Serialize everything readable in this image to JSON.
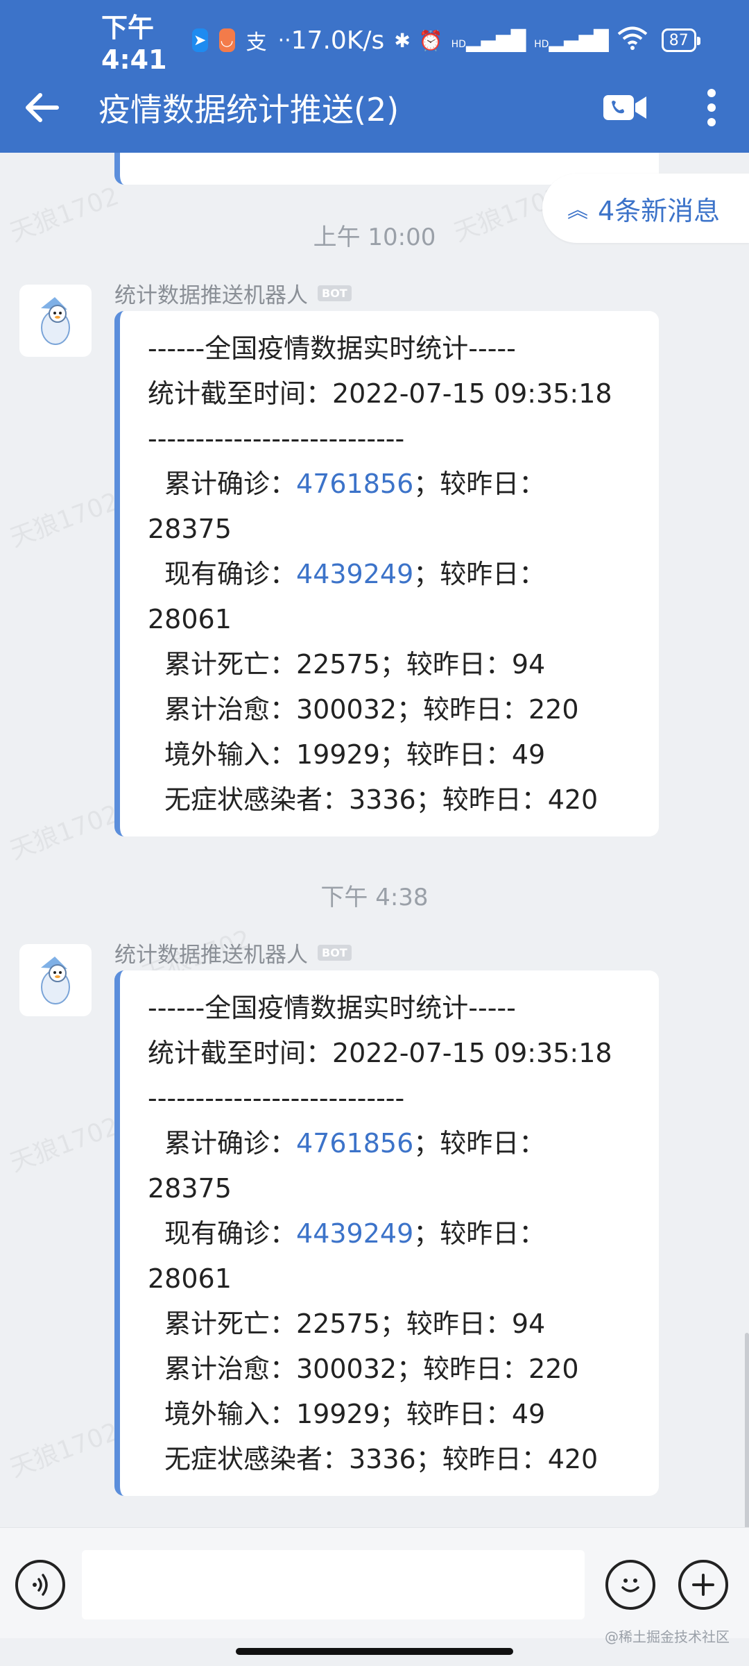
{
  "status_bar": {
    "time": "下午4:41",
    "net_speed": "17.0K/s",
    "sig1": "HD",
    "sig2": "HD",
    "battery": "87",
    "dots": "··"
  },
  "header": {
    "title": "疫情数据统计推送(2)"
  },
  "new_messages": "4条新消息",
  "messages": [
    {
      "time": "上午 10:00",
      "sender": "统计数据推送机器人",
      "badge": "BOT",
      "lines": {
        "l1": "------全国疫情数据实时统计-----",
        "l2": "统计截至时间：2022-07-15 09:35:18",
        "l3": "---------------------------",
        "confirmed_label": "累计确诊：",
        "confirmed_value": "4761856",
        "confirmed_tail": "；较昨日：",
        "confirmed_delta": "28375",
        "current_label": "现有确诊：",
        "current_value": "4439249",
        "current_tail": "；较昨日：",
        "current_delta": "28061",
        "deaths": "累计死亡：22575；较昨日：94",
        "cured": "累计治愈：300032；较昨日：220",
        "imported": "境外输入：19929；较昨日：49",
        "asymptomatic": "无症状感染者：3336；较昨日：420"
      }
    },
    {
      "time": "下午 4:38",
      "sender": "统计数据推送机器人",
      "badge": "BOT",
      "lines": {
        "l1": "------全国疫情数据实时统计-----",
        "l2": "统计截至时间：2022-07-15 09:35:18",
        "l3": "---------------------------",
        "confirmed_label": "累计确诊：",
        "confirmed_value": "4761856",
        "confirmed_tail": "；较昨日：",
        "confirmed_delta": "28375",
        "current_label": "现有确诊：",
        "current_value": "4439249",
        "current_tail": "；较昨日：",
        "current_delta": "28061",
        "deaths": "累计死亡：22575；较昨日：94",
        "cured": "累计治愈：300032；较昨日：220",
        "imported": "境外输入：19929；较昨日：49",
        "asymptomatic": "无症状感染者：3336；较昨日：420"
      }
    }
  ],
  "input": {
    "placeholder": ""
  },
  "watermark": "天狼1702",
  "credit": "@稀土掘金技术社区",
  "colors": {
    "header_bg": "#3c73c9",
    "link_blue": "#3c73c9",
    "card_accent": "#5b8edb"
  }
}
